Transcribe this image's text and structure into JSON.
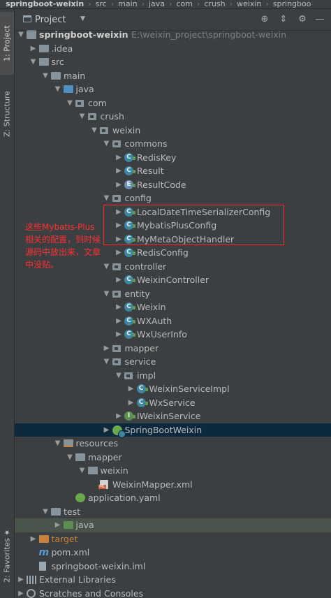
{
  "breadcrumb": [
    "springboot-weixin",
    "src",
    "main",
    "java",
    "com",
    "crush",
    "weixin",
    "springboo"
  ],
  "left_tabs": {
    "project": "1: Project",
    "structure": "Z: Structure",
    "favorites": "2: Favorites"
  },
  "toolbar": {
    "title": "Project",
    "icons": [
      "target-icon",
      "collapse-icon",
      "settings-gear-icon",
      "hide-icon"
    ]
  },
  "annotation": {
    "note": "这些Mybatis-Plus相关的配置，到时候源码中放出来，文章中没贴。",
    "color": "#ff3030"
  },
  "tree": [
    {
      "label": "springboot-weixin",
      "path": "E:\\weixin_project\\springboot-weixin",
      "icon": "project-folder-icon",
      "depth": 0,
      "expanded": true
    },
    {
      "label": ".idea",
      "icon": "folder-icon",
      "depth": 1,
      "expanded": false
    },
    {
      "label": "src",
      "icon": "folder-icon",
      "depth": 1,
      "expanded": true
    },
    {
      "label": "main",
      "icon": "folder-icon",
      "depth": 2,
      "expanded": true
    },
    {
      "label": "java",
      "icon": "source-folder-icon",
      "depth": 3,
      "expanded": true
    },
    {
      "label": "com",
      "icon": "package-icon",
      "depth": 4,
      "expanded": true
    },
    {
      "label": "crush",
      "icon": "package-icon",
      "depth": 5,
      "expanded": true
    },
    {
      "label": "weixin",
      "icon": "package-icon",
      "depth": 6,
      "expanded": true
    },
    {
      "label": "commons",
      "icon": "package-icon",
      "depth": 7,
      "expanded": true
    },
    {
      "label": "RedisKey",
      "icon": "class-icon",
      "depth": 8,
      "expanded": false
    },
    {
      "label": "Result",
      "icon": "class-icon",
      "depth": 8,
      "expanded": false
    },
    {
      "label": "ResultCode",
      "icon": "enum-icon",
      "depth": 8,
      "expanded": false
    },
    {
      "label": "config",
      "icon": "package-icon",
      "depth": 7,
      "expanded": true
    },
    {
      "label": "LocalDateTimeSerializerConfig",
      "icon": "class-icon",
      "depth": 8,
      "expanded": false
    },
    {
      "label": "MybatisPlusConfig",
      "icon": "class-icon",
      "depth": 8,
      "expanded": false
    },
    {
      "label": "MyMetaObjectHandler",
      "icon": "class-icon",
      "depth": 8,
      "expanded": false
    },
    {
      "label": "RedisConfig",
      "icon": "class-icon",
      "depth": 8,
      "expanded": false
    },
    {
      "label": "controller",
      "icon": "package-icon",
      "depth": 7,
      "expanded": true
    },
    {
      "label": "WeixinController",
      "icon": "class-icon",
      "depth": 8,
      "expanded": false
    },
    {
      "label": "entity",
      "icon": "package-icon",
      "depth": 7,
      "expanded": true
    },
    {
      "label": "Weixin",
      "icon": "class-icon",
      "depth": 8,
      "expanded": false
    },
    {
      "label": "WXAuth",
      "icon": "class-icon",
      "depth": 8,
      "expanded": false
    },
    {
      "label": "WxUserInfo",
      "icon": "class-icon",
      "depth": 8,
      "expanded": false
    },
    {
      "label": "mapper",
      "icon": "package-icon",
      "depth": 7,
      "expanded": false
    },
    {
      "label": "service",
      "icon": "package-icon",
      "depth": 7,
      "expanded": true
    },
    {
      "label": "impl",
      "icon": "package-icon",
      "depth": 8,
      "expanded": true
    },
    {
      "label": "WeixinServiceImpl",
      "icon": "class-icon",
      "depth": 9,
      "expanded": false
    },
    {
      "label": "WxService",
      "icon": "class-icon",
      "depth": 9,
      "expanded": false
    },
    {
      "label": "IWeixinService",
      "icon": "interface-icon",
      "depth": 8,
      "expanded": false
    },
    {
      "label": "SpringBootWeixin",
      "icon": "spring-boot-app-icon",
      "depth": 7,
      "expanded": false,
      "selected": true
    },
    {
      "label": "resources",
      "icon": "resources-folder-icon",
      "depth": 3,
      "expanded": true
    },
    {
      "label": "mapper",
      "icon": "folder-icon",
      "depth": 4,
      "expanded": true
    },
    {
      "label": "weixin",
      "icon": "folder-icon",
      "depth": 5,
      "expanded": true
    },
    {
      "label": "WeixinMapper.xml",
      "icon": "xml-file-icon",
      "depth": 6,
      "leaf": true
    },
    {
      "label": "application.yaml",
      "icon": "yaml-file-icon",
      "depth": 4,
      "leaf": true
    },
    {
      "label": "test",
      "icon": "folder-icon",
      "depth": 2,
      "expanded": true
    },
    {
      "label": "java",
      "icon": "test-folder-icon",
      "depth": 3,
      "expanded": false,
      "highlight": "test"
    },
    {
      "label": "target",
      "icon": "excluded-folder-icon",
      "depth": 1,
      "expanded": false,
      "orange": true
    },
    {
      "label": "pom.xml",
      "icon": "maven-file-icon",
      "depth": 1,
      "leaf": true
    },
    {
      "label": "springboot-weixin.iml",
      "icon": "iml-file-icon",
      "depth": 1,
      "leaf": true
    },
    {
      "label": "External Libraries",
      "icon": "libraries-icon",
      "depth": 0,
      "expanded": false
    },
    {
      "label": "Scratches and Consoles",
      "icon": "scratches-icon",
      "depth": 0,
      "expanded": false
    }
  ]
}
